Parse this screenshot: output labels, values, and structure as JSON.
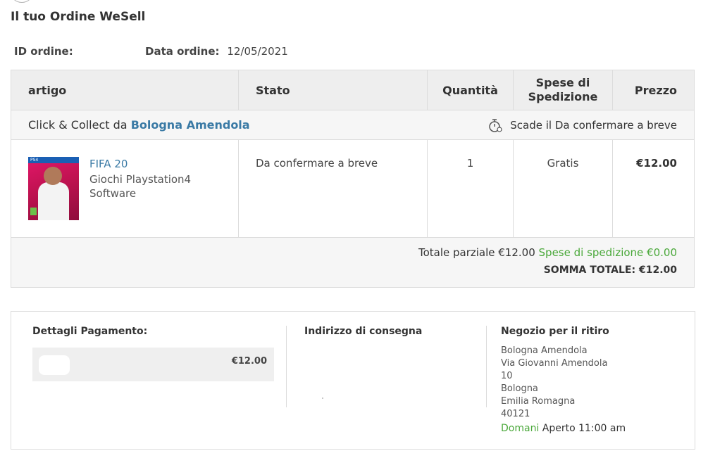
{
  "page": {
    "title": "Il tuo Ordine WeSell"
  },
  "order": {
    "id_label": "ID ordine:",
    "id_value": "",
    "date_label": "Data ordine:",
    "date_value": "12/05/2021"
  },
  "table": {
    "headers": [
      "artigo",
      "Stato",
      "Quantità",
      "Spese di Spedizione",
      "Prezzo"
    ],
    "collect": {
      "prefix": "Click & Collect da",
      "store": "Bologna Amendola",
      "expiry": "Scade il Da confermare a breve"
    },
    "items": [
      {
        "name": "FIFA 20",
        "category": "Giochi Playstation4",
        "subcategory": "Software",
        "status": "Da confermare a breve",
        "quantity": "1",
        "shipping": "Gratis",
        "price": "€12.00",
        "image_band_text": "PS4",
        "image_rating": "3"
      }
    ],
    "totals": {
      "subtotal": "Totale parziale €12.00",
      "shipping": "Spese di spedizione €0.00",
      "grand": "SOMMA TOTALE: €12.00"
    }
  },
  "details": {
    "payment_title": "Dettagli Pagamento:",
    "payment_amount": "€12.00",
    "address_title": "Indirizzo di consegna",
    "store_title": "Negozio per il ritiro",
    "store_lines": [
      "Bologna Amendola",
      "Via Giovanni Amendola",
      "10",
      "Bologna",
      "Emilia Romagna",
      "40121"
    ],
    "hours_day": "Domani",
    "hours_text": "Aperto 11:00 am"
  },
  "colors": {
    "link_blue": "#3a7aa5",
    "green": "#4aa83a",
    "border": "#dcdcdc",
    "header_bg": "#eeeeee"
  },
  "icons": {
    "timer": "stopwatch-icon",
    "payment": "payment-method-icon"
  }
}
